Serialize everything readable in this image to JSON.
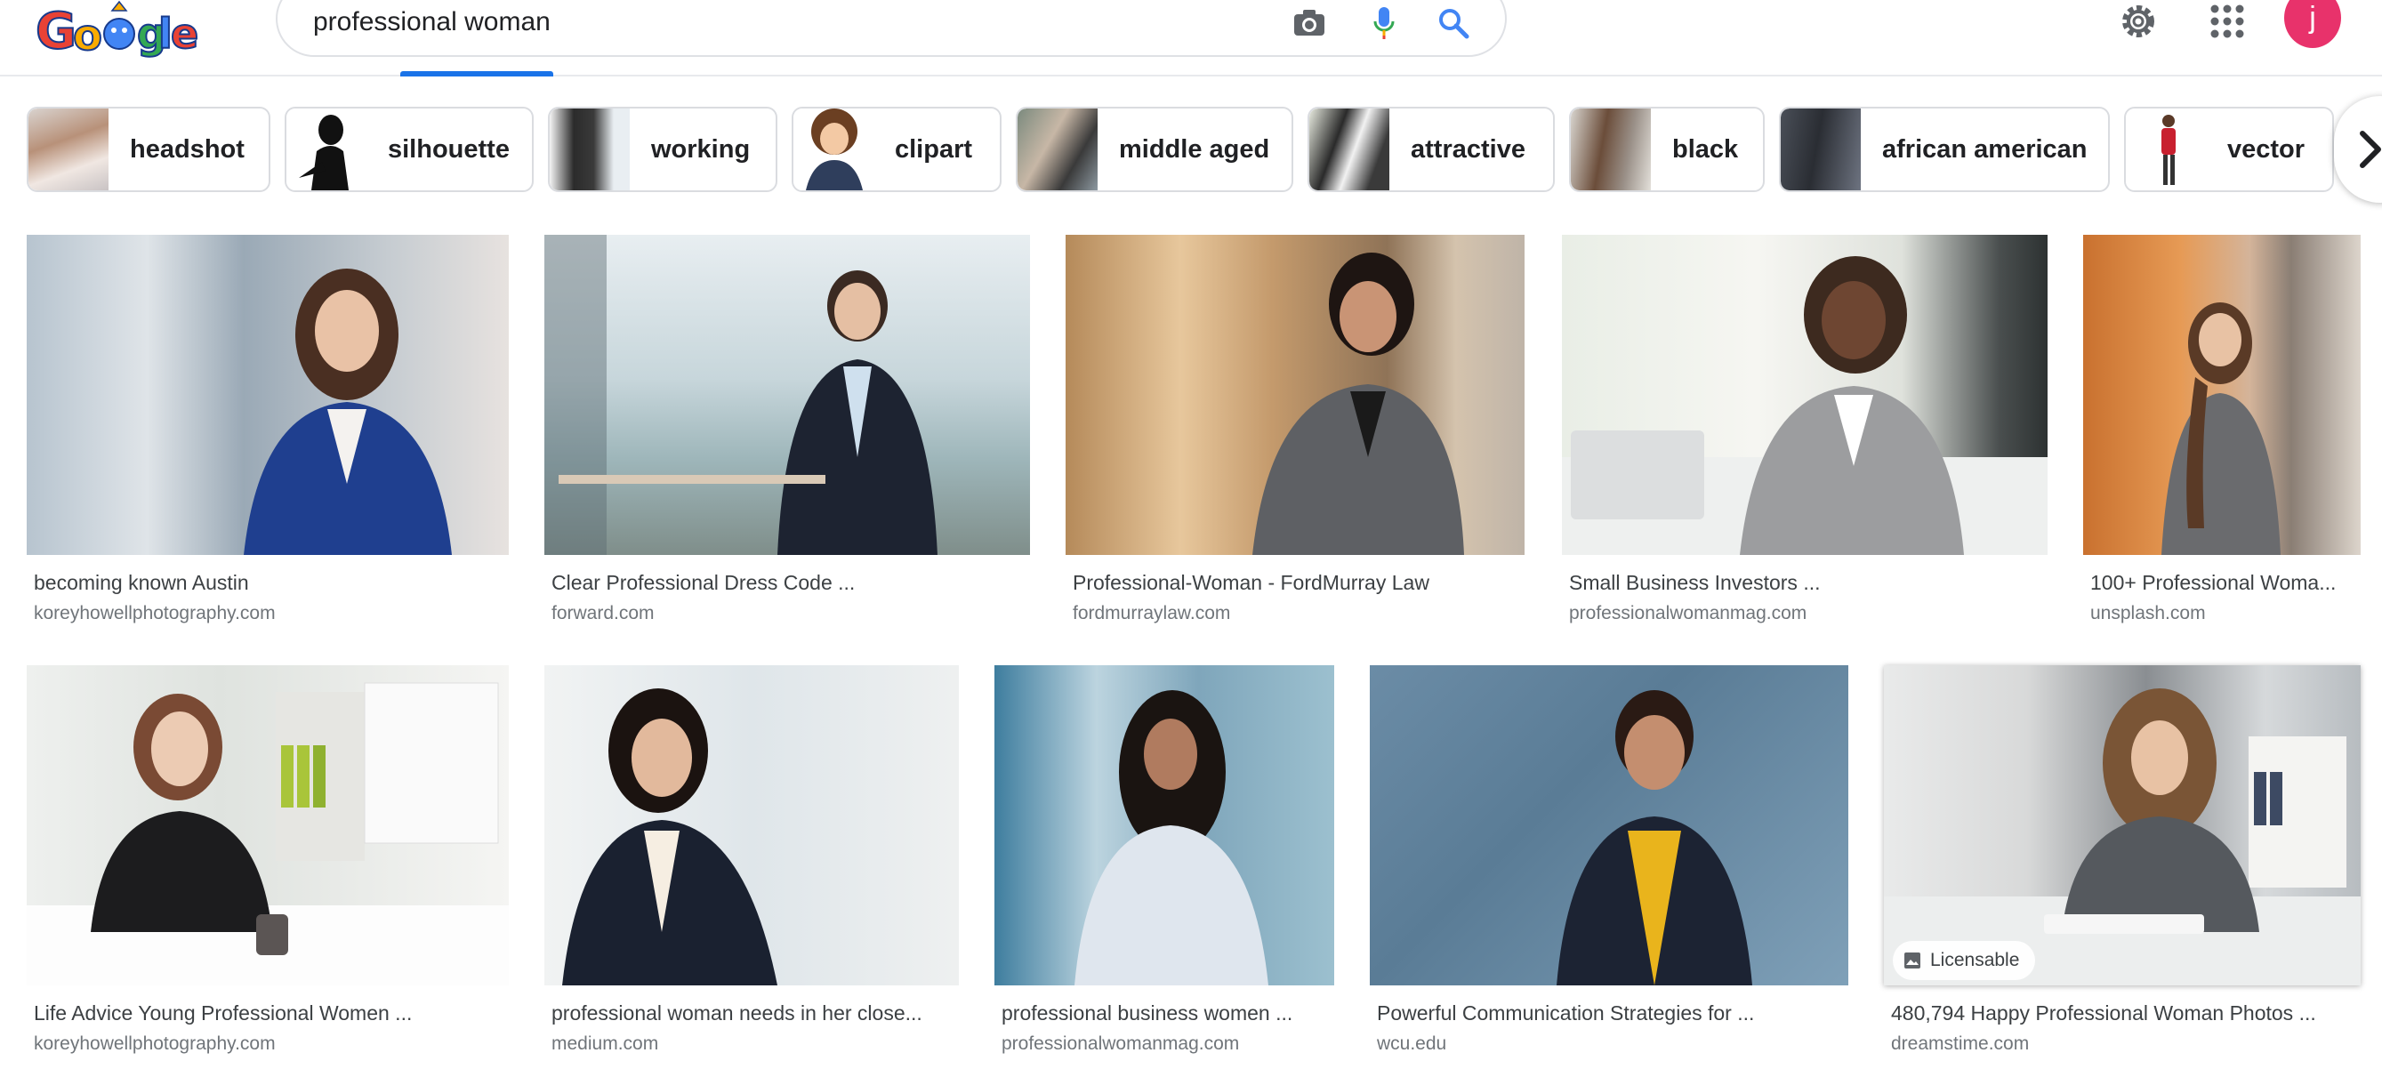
{
  "search": {
    "query": "professional woman"
  },
  "profile": {
    "initial": "j"
  },
  "colors": {
    "accent": "#1a73e8",
    "avatar": "#e8326b",
    "chip_border": "#dadce0"
  },
  "icons": [
    "google-doodle-logo",
    "camera-icon",
    "mic-icon",
    "search-icon",
    "settings-gear-icon",
    "apps-grid-icon",
    "chevron-right-icon",
    "image-icon"
  ],
  "chips": [
    {
      "label": "headshot"
    },
    {
      "label": "silhouette"
    },
    {
      "label": "working"
    },
    {
      "label": "clipart"
    },
    {
      "label": "middle aged"
    },
    {
      "label": "attractive"
    },
    {
      "label": "black"
    },
    {
      "label": "african american"
    },
    {
      "label": "vector"
    }
  ],
  "results": [
    {
      "title": "becoming known Austin",
      "domain": "koreyhowellphotography.com"
    },
    {
      "title": "Clear Professional Dress Code ...",
      "domain": "forward.com"
    },
    {
      "title": "Professional-Woman - FordMurray Law",
      "domain": "fordmurraylaw.com"
    },
    {
      "title": "Small Business Investors ...",
      "domain": "professionalwomanmag.com"
    },
    {
      "title": "100+ Professional Woma...",
      "domain": "unsplash.com"
    },
    {
      "title": "Life Advice Young Professional Women ...",
      "domain": "koreyhowellphotography.com"
    },
    {
      "title": "professional woman needs in her close...",
      "domain": "medium.com"
    },
    {
      "title": "professional business women ...",
      "domain": "professionalwomanmag.com"
    },
    {
      "title": "Powerful Communication Strategies for ...",
      "domain": "wcu.edu"
    },
    {
      "title": "480,794 Happy Professional Woman Photos ...",
      "domain": "dreamstime.com",
      "badge": "Licensable"
    }
  ]
}
